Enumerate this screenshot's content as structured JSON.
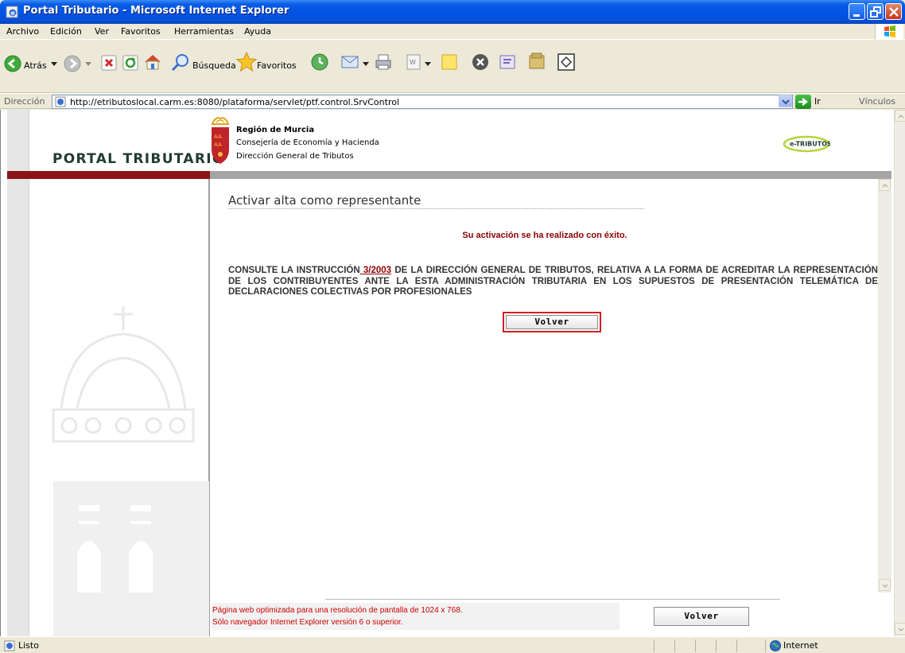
{
  "window": {
    "title": "Portal Tributario - Microsoft Internet Explorer"
  },
  "menu": {
    "items": [
      "Archivo",
      "Edición",
      "Ver",
      "Favoritos",
      "Herramientas",
      "Ayuda"
    ]
  },
  "toolbar": {
    "back_label": "Atrás",
    "search_label": "Búsqueda",
    "favorites_label": "Favoritos"
  },
  "address": {
    "label": "Dirección",
    "url": "http://etributoslocal.carm.es:8080/plataforma/servlet/ptf.control.SrvControl",
    "go_label": "Ir",
    "links_label": "Vínculos"
  },
  "header": {
    "portal_title": "PORTAL TRIBUTARIO",
    "region": "Región de Murcia",
    "consejeria": "Consejería de Economía y Hacienda",
    "direccion": "Dirección General de Tributos",
    "logo_text": "e-TRIBUTOS"
  },
  "main": {
    "heading": "Activar alta como representante",
    "success_message": "Su activación se ha realizado con éxito.",
    "instruction_before": "CONSULTE LA INSTRUCCIÓN",
    "instruction_link": " 3/2003",
    "instruction_after": " DE LA DIRECCIÓN GENERAL DE TRIBUTOS, RELATIVA A LA FORMA DE ACREDITAR LA REPRESENTACIÓN DE LOS CONTRIBUYENTES ANTE LA ESTA ADMINISTRACIÓN TRIBUTARIA EN LOS SUPUESTOS DE PRESENTACIÓN TELEMÁTICA DE DECLARACIONES COLECTIVAS POR PROFESIONALES",
    "volver_label": "Volver"
  },
  "footer": {
    "line1": "Página web optimizada para una resolución de pantalla de 1024 x 768.",
    "line2": "Sólo navegador Internet Explorer versión 6 o superior.",
    "volver_label": "Volver"
  },
  "status": {
    "text": "Listo",
    "zone": "Internet"
  },
  "colors": {
    "accent_red": "#8B1416",
    "titlebar_blue": "#0054E3",
    "success_text": "#8B0000"
  }
}
